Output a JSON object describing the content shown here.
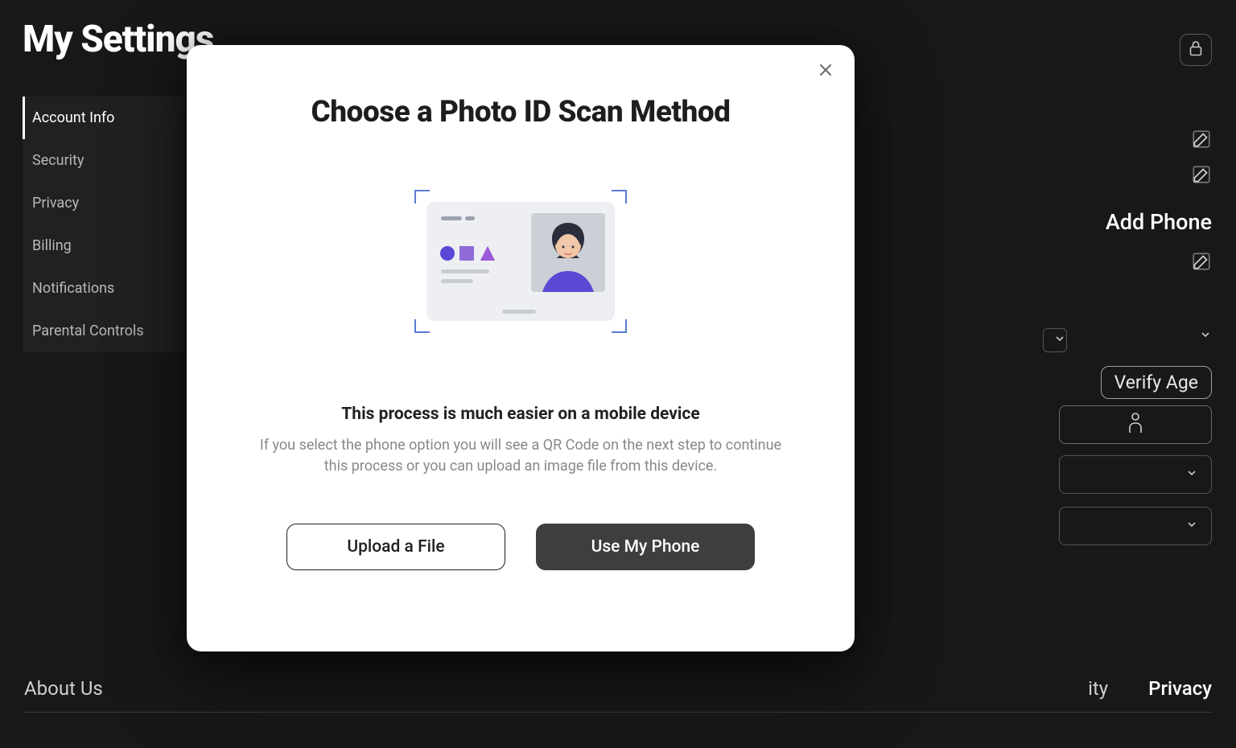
{
  "page": {
    "title": "My Settings"
  },
  "sidebar": {
    "items": [
      {
        "label": "Account Info",
        "active": true
      },
      {
        "label": "Security"
      },
      {
        "label": "Privacy"
      },
      {
        "label": "Billing"
      },
      {
        "label": "Notifications"
      },
      {
        "label": "Parental Controls"
      }
    ]
  },
  "account": {
    "add_phone_label": "Add Phone",
    "verify_age_label": "Verify Age"
  },
  "footer": {
    "about": "About Us",
    "link_partial": "ity",
    "privacy": "Privacy"
  },
  "modal": {
    "title": "Choose a Photo ID Scan Method",
    "subtitle": "This process is much easier on a mobile device",
    "description": "If you select the phone option you will see a QR Code on the next step to continue this process or you can upload an image file from this device.",
    "upload_label": "Upload a File",
    "phone_label": "Use My Phone"
  }
}
